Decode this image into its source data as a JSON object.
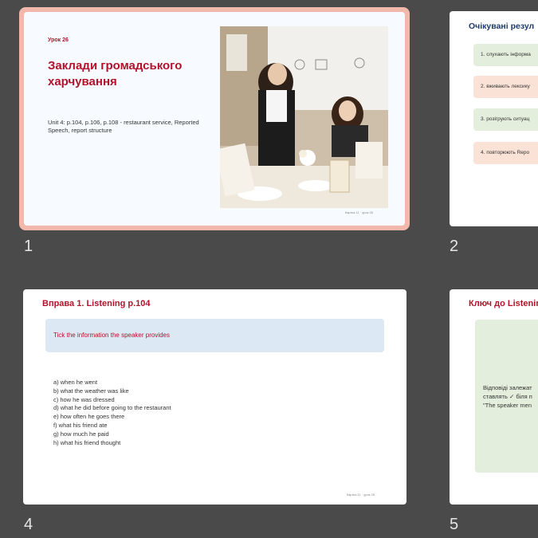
{
  "slides": [
    {
      "number": "1",
      "lesson_label": "Урок 26",
      "title": "Заклади громадського харчування",
      "subtitle": "Unit 4: p.104, p.106, p.108 - restaurant service, Reported Speech, report structure",
      "footer": "Картка 11 · урок 26"
    },
    {
      "number": "2",
      "title": "Очікувані резул",
      "pills": [
        "1. слухають інформа",
        "2. вживають лексику",
        "3. розігрують ситуац",
        "4. повторюють Repo"
      ]
    },
    {
      "number": "4",
      "title": "Вправа 1. Listening p.104",
      "instruction": "Tick the information the speaker provides",
      "items": [
        "a) when he went",
        "b) what the weather was like",
        "c) how he was dressed",
        "d) what he did before going to the restaurant",
        "e) how often he goes there",
        "f) what his friend ate",
        "g) how much he paid",
        "h) what his friend thought"
      ],
      "footer": "Картка 11 · урок 26"
    },
    {
      "number": "5",
      "title": "Ключ до Listenin",
      "answer_lines": [
        "Відповіді залежат",
        "ставлять ✓ біля п",
        "\"The speaker men"
      ]
    }
  ],
  "colors": {
    "background": "#4a4a4a",
    "accent_red": "#b3122a",
    "accent_navy": "#1f3b6b",
    "selection": "#f3b8ac"
  }
}
